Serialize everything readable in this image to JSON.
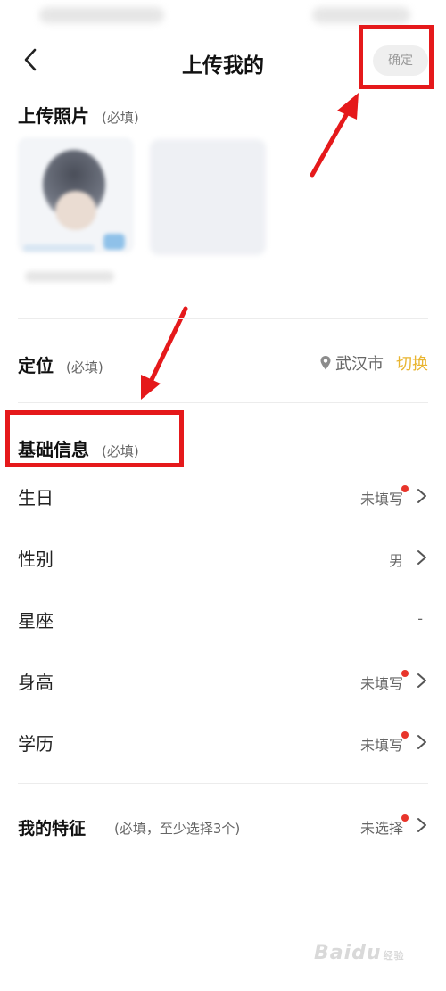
{
  "header": {
    "title": "上传我的",
    "confirm_label": "确定"
  },
  "photos": {
    "title": "上传照片",
    "hint": "(必填)"
  },
  "location": {
    "title": "定位",
    "hint": "(必填)",
    "city": "武汉市",
    "switch_label": "切换"
  },
  "basic_info": {
    "title": "基础信息",
    "hint": "(必填)",
    "rows": [
      {
        "label": "生日",
        "value": "未填写",
        "required_dot": true
      },
      {
        "label": "性别",
        "value": "男",
        "required_dot": false
      },
      {
        "label": "星座",
        "value": "-",
        "required_dot": false
      },
      {
        "label": "身高",
        "value": "未填写",
        "required_dot": true
      },
      {
        "label": "学历",
        "value": "未填写",
        "required_dot": true
      }
    ]
  },
  "features": {
    "title": "我的特征",
    "hint": "(必填，至少选择3个)",
    "value": "未选择"
  },
  "watermark": {
    "brand": "Baidu",
    "sub": "经验"
  },
  "colors": {
    "annotation_red": "#e5191b",
    "accent_yellow": "#e9b531",
    "required_dot": "#e8352b"
  }
}
